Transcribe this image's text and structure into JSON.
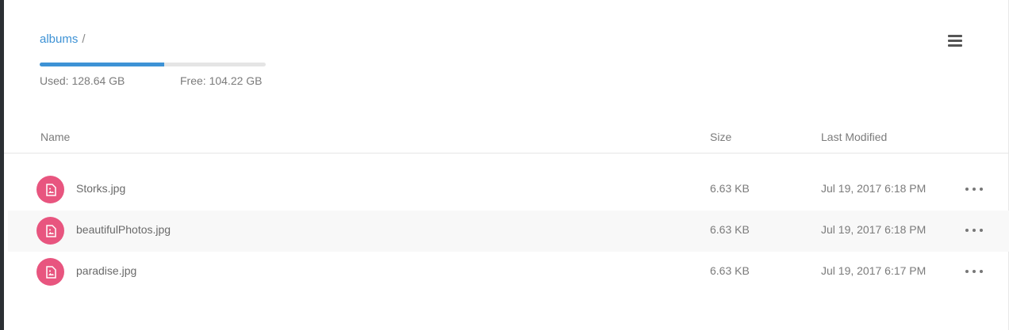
{
  "breadcrumb": {
    "folder": "albums",
    "separator": "/"
  },
  "storage": {
    "used_label": "Used: 128.64 GB",
    "free_label": "Free: 104.22 GB",
    "used_fraction": 0.552
  },
  "icons": {
    "menu": "hamburger-menu-icon",
    "file": "image-file-icon",
    "more": "ellipsis-icon"
  },
  "colors": {
    "accent": "#3d92d5",
    "file_icon": "#e8557f"
  },
  "table": {
    "columns": [
      "Name",
      "Size",
      "Last Modified"
    ],
    "rows": [
      {
        "name": "Storks.jpg",
        "size": "6.63 KB",
        "modified": "Jul 19, 2017 6:18 PM"
      },
      {
        "name": "beautifulPhotos.jpg",
        "size": "6.63 KB",
        "modified": "Jul 19, 2017 6:18 PM"
      },
      {
        "name": "paradise.jpg",
        "size": "6.63 KB",
        "modified": "Jul 19, 2017 6:17 PM"
      }
    ]
  }
}
